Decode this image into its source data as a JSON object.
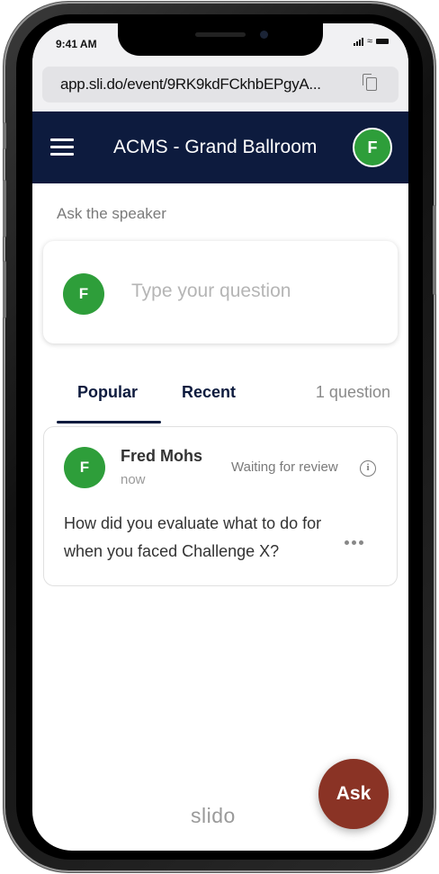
{
  "status_bar": {
    "time": "9:41 AM"
  },
  "browser": {
    "url": "app.sli.do/event/9RK9kdFCkhbEPgyA...",
    "copy_icon": "copy-icon"
  },
  "header": {
    "title": "ACMS - Grand Ballroom",
    "user_initial": "F",
    "menu_icon": "hamburger-menu-icon",
    "background": "#0d1b3e"
  },
  "compose": {
    "label": "Ask the speaker",
    "avatar_initial": "F",
    "placeholder": "Type your question"
  },
  "tabs": {
    "popular": "Popular",
    "recent": "Recent",
    "active": "Popular",
    "count": "1 question"
  },
  "questions": [
    {
      "avatar_initial": "F",
      "author": "Fred Mohs",
      "time": "now",
      "status": "Waiting for review",
      "text": "How did you evaluate what to do for when you faced Challenge X?"
    }
  ],
  "footer": {
    "logo": "slido",
    "ask_button": "Ask",
    "ask_color": "#8a3325"
  },
  "colors": {
    "avatar_green": "#2e9e3a"
  }
}
